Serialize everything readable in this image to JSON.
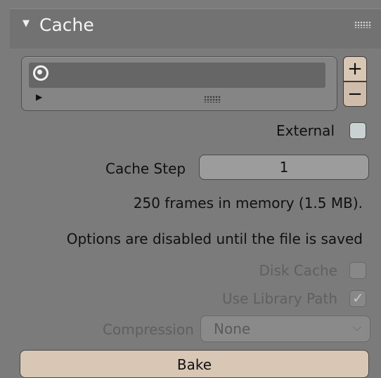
{
  "panel": {
    "title": "Cache",
    "collapse_icon": "triangle-down-icon",
    "grip_icon": "drag-grip-icon"
  },
  "cache_list": {
    "item_icon": "point-cache-icon",
    "item_label": "",
    "expand_icon": "triangle-right-icon",
    "resize_icon": "resize-grip-icon",
    "add_label": "+",
    "remove_label": "−"
  },
  "external": {
    "label": "External",
    "checked": false
  },
  "cache_step": {
    "label": "Cache Step",
    "value": "1"
  },
  "info": {
    "frames_in_memory": "250 frames in memory (1.5 MB).",
    "disabled_notice": "Options are disabled until the file is saved"
  },
  "disk_cache": {
    "label": "Disk Cache",
    "checked": false
  },
  "use_library_path": {
    "label": "Use Library Path",
    "checked": true
  },
  "compression": {
    "label": "Compression",
    "value": "None"
  },
  "bake": {
    "label": "Bake"
  },
  "colors": {
    "panel_bg": "#7b7b7b",
    "header_bg": "#727272",
    "button_accent": "#d9c7b6"
  }
}
